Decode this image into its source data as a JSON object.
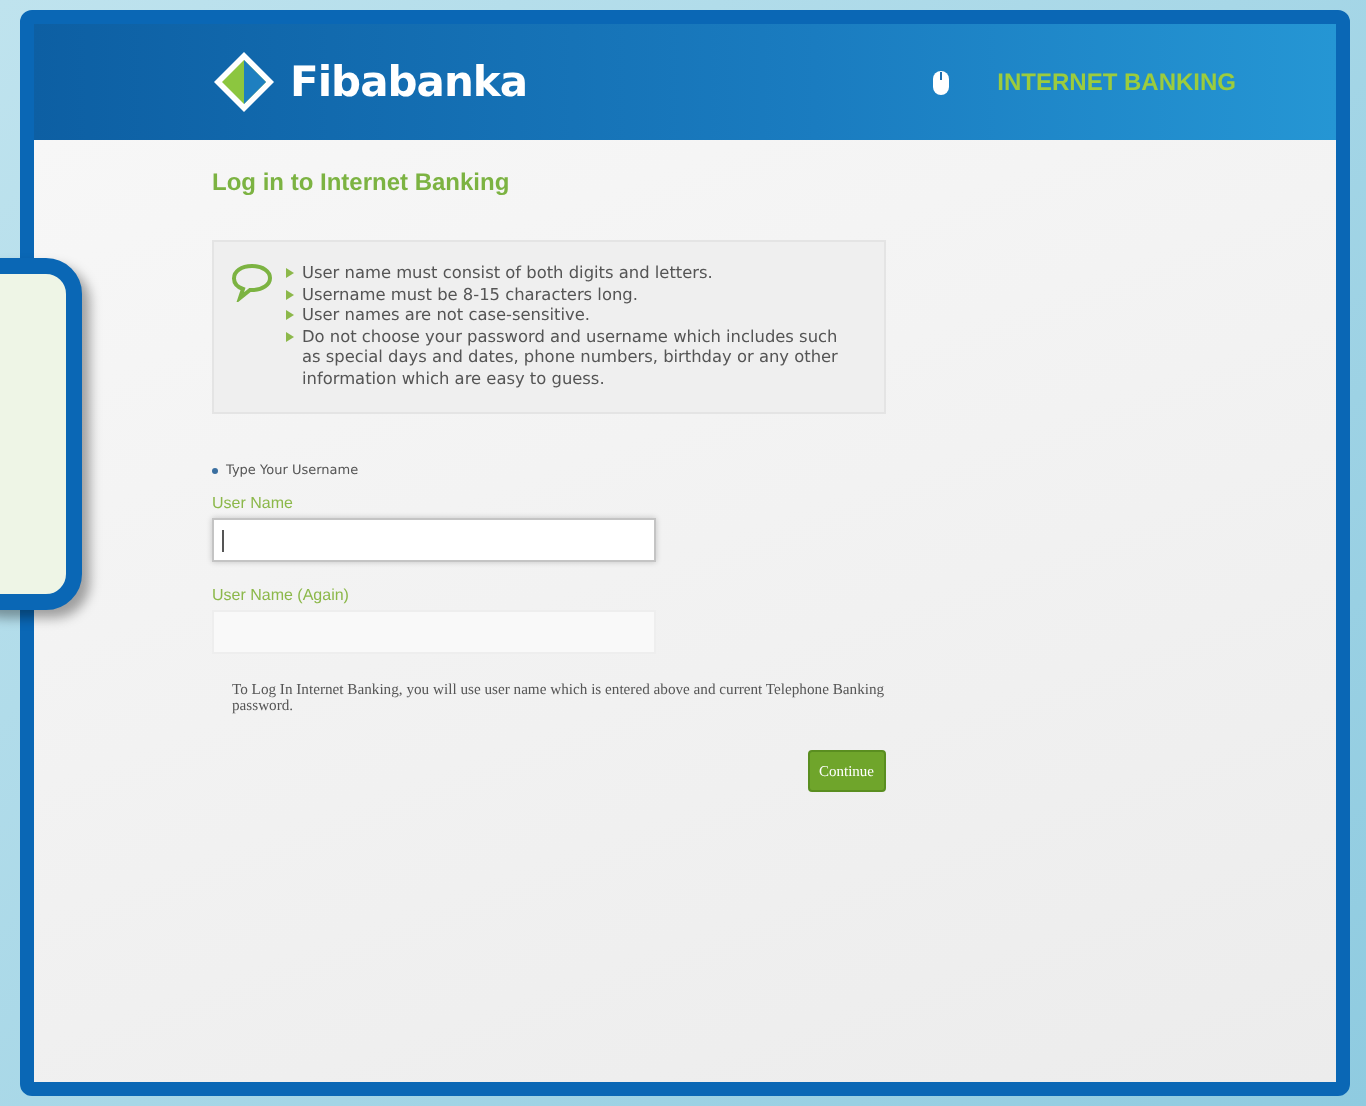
{
  "header": {
    "brand": "Fibabanka",
    "section_link": "INTERNET BANKING"
  },
  "page_title": "Log in to Internet Banking",
  "rules": [
    "User name must consist of both digits and letters.",
    "Username must be 8-15 characters long.",
    "User names are not case-sensitive.",
    "Do not choose your password and username which includes such as special days and dates, phone numbers, birthday or any other information which are easy to guess."
  ],
  "step_label": "Type Your Username",
  "fields": [
    {
      "label": "User Name",
      "focused": true
    },
    {
      "label": "User Name (Again)",
      "focused": false
    }
  ],
  "note": "To Log In Internet Banking, you will use user name which is entered above and current Telephone Banking password.",
  "buttons": [
    "Continue"
  ]
}
